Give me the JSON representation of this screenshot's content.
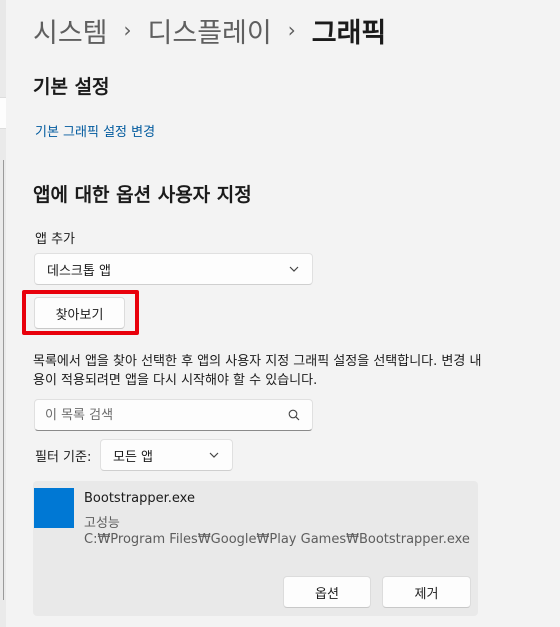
{
  "breadcrumb": {
    "items": [
      "시스템",
      "디스플레이"
    ],
    "separator": "›",
    "current": "그래픽"
  },
  "basic_settings": {
    "heading": "기본 설정",
    "link": "기본 그래픽 설정 변경"
  },
  "custom_options": {
    "heading": "앱에 대한 옵션 사용자 지정",
    "add_app_label": "앱 추가",
    "app_type_selected": "데스크톱 앱",
    "browse_button": "찾아보기",
    "description": "목록에서 앱을 찾아 선택한 후 앱의 사용자 지정 그래픽 설정을 선택합니다. 변경 내용이 적용되려면 앱을 다시 시작해야 할 수 있습니다.",
    "search_placeholder": "이 목록 검색",
    "filter_label": "필터 기준:",
    "filter_selected": "모든 앱"
  },
  "apps": [
    {
      "name": "Bootstrapper.exe",
      "preference": "고성능",
      "path": "C:₩Program Files₩Google₩Play Games₩Bootstrapper.exe",
      "tile_color": "#0078d4",
      "options_button": "옵션",
      "remove_button": "제거"
    }
  ],
  "colors": {
    "accent": "#0078d4",
    "link": "#005a9e",
    "highlight": "#e8000b",
    "background": "#f3f3f3"
  },
  "icons": {
    "dropdown": "chevron-down-icon",
    "search": "search-icon"
  }
}
